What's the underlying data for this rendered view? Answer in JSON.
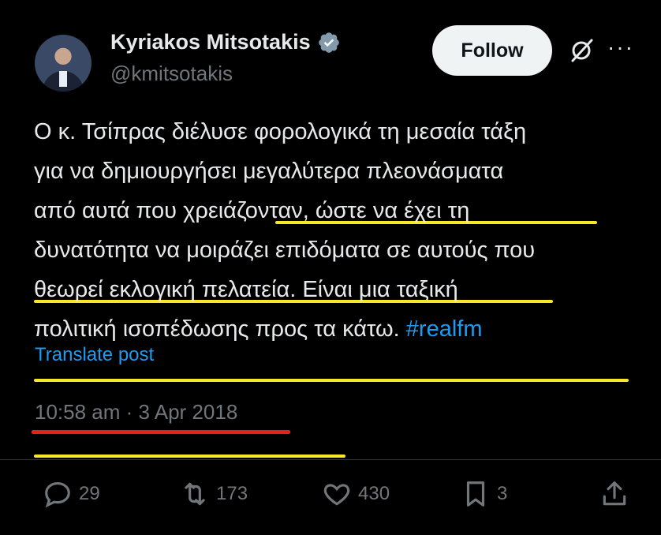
{
  "author": {
    "name": "Kyriakos Mitsotakis",
    "handle": "@kmitsotakis",
    "verified": true
  },
  "follow_label": "Follow",
  "tweet": {
    "lines": [
      "Ο κ. Τσίπρας διέλυσε φορολογικά τη μεσαία τάξη",
      "για να δημιουργήσει μεγαλύτερα πλεονάσματα",
      "από αυτά που χρειάζονταν, ώστε να έχει τη",
      "δυνατότητα να μοιράζει επιδόματα σε αυτούς που",
      "θεωρεί εκλογική πελατεία. Είναι μια ταξική",
      "πολιτική ισοπέδωσης προς τα κάτω."
    ],
    "hashtag": "#realfm"
  },
  "translate_label": "Translate post",
  "timestamp": "10:58 am · 3 Apr 2018",
  "actions": {
    "replies": "29",
    "reposts": "173",
    "likes": "430",
    "bookmarks": "3"
  },
  "colors": {
    "highlight_underline": "#f7e726",
    "timestamp_underline": "#e0231b",
    "link": "#1d9bf0"
  }
}
